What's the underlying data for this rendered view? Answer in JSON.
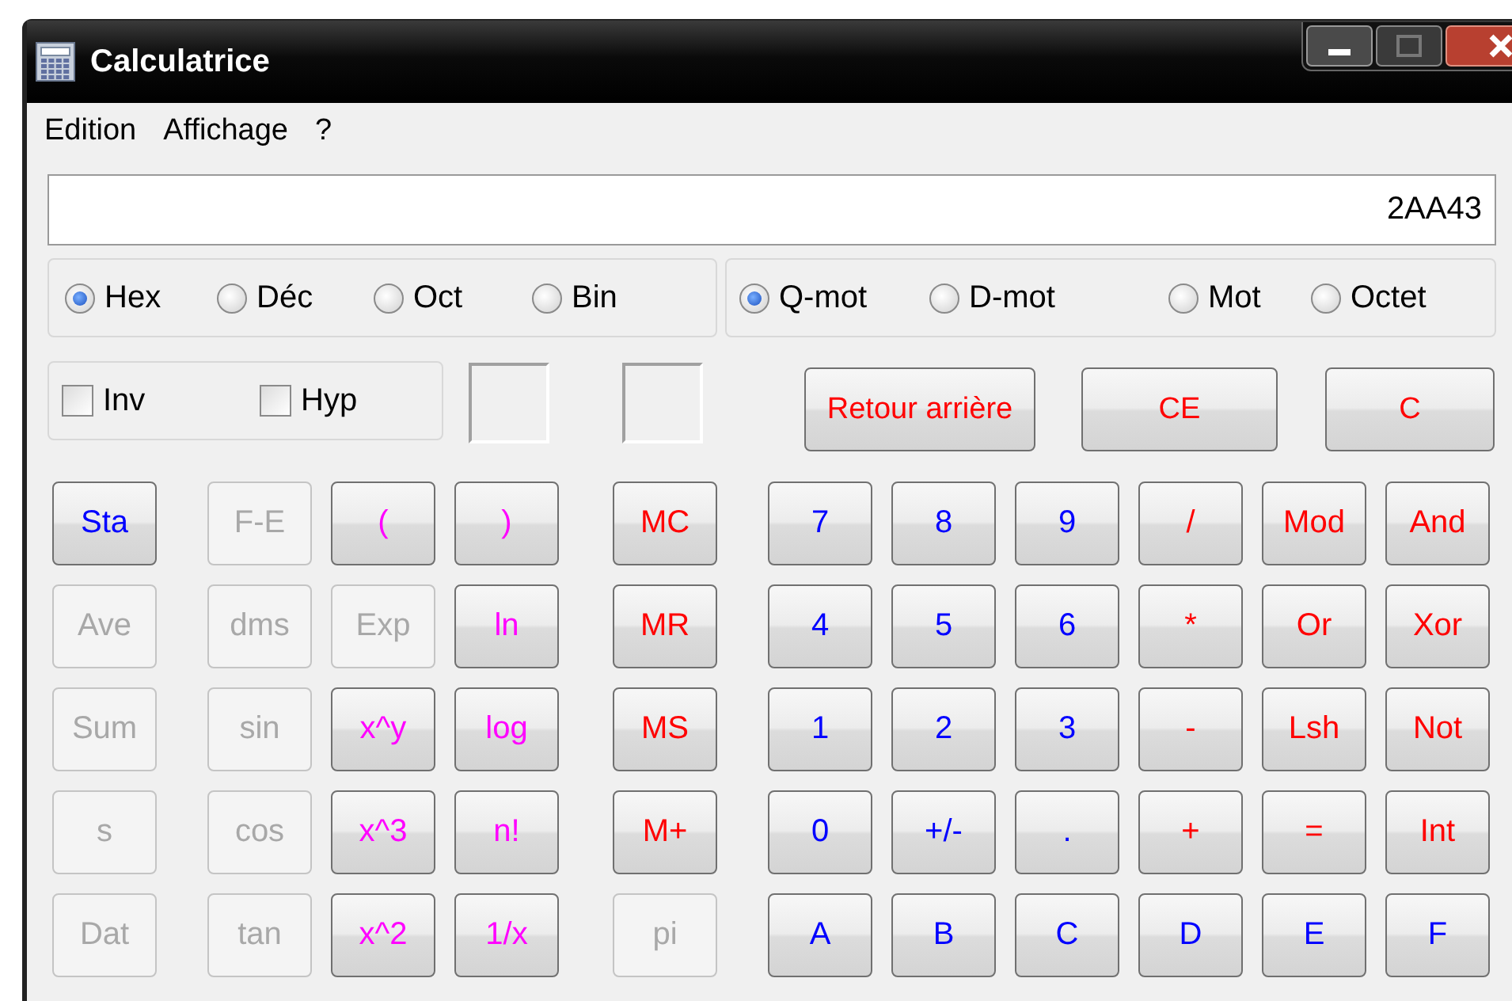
{
  "window": {
    "title": "Calculatrice"
  },
  "menu": [
    {
      "label": "Edition"
    },
    {
      "label": "Affichage"
    },
    {
      "label": "?"
    }
  ],
  "display": {
    "value": "2AA43"
  },
  "bases": [
    {
      "label": "Hex",
      "selected": true
    },
    {
      "label": "Déc",
      "selected": false
    },
    {
      "label": "Oct",
      "selected": false
    },
    {
      "label": "Bin",
      "selected": false
    }
  ],
  "word_sizes": [
    {
      "label": "Q-mot",
      "selected": true
    },
    {
      "label": "D-mot",
      "selected": false
    },
    {
      "label": "Mot",
      "selected": false
    },
    {
      "label": "Octet",
      "selected": false
    }
  ],
  "modifiers": [
    {
      "label": "Inv",
      "checked": false
    },
    {
      "label": "Hyp",
      "checked": false
    }
  ],
  "edit_buttons": [
    {
      "label": "Retour arrière",
      "color": "#ff0000"
    },
    {
      "label": "CE",
      "color": "#ff0000"
    },
    {
      "label": "C",
      "color": "#ff0000"
    }
  ],
  "keys": [
    [
      {
        "label": "Sta",
        "color": "#0000ff",
        "disabled": false
      },
      {
        "label": "F-E",
        "disabled": true
      },
      {
        "label": "(",
        "color": "#ff00ff",
        "disabled": false
      },
      {
        "label": ")",
        "color": "#ff00ff",
        "disabled": false
      },
      {
        "label": "MC",
        "color": "#ff0000",
        "disabled": false
      },
      {
        "label": "7",
        "color": "#0000ff",
        "disabled": false
      },
      {
        "label": "8",
        "color": "#0000ff",
        "disabled": false
      },
      {
        "label": "9",
        "color": "#0000ff",
        "disabled": false
      },
      {
        "label": "/",
        "color": "#ff0000",
        "disabled": false
      },
      {
        "label": "Mod",
        "color": "#ff0000",
        "disabled": false
      },
      {
        "label": "And",
        "color": "#ff0000",
        "disabled": false
      }
    ],
    [
      {
        "label": "Ave",
        "disabled": true
      },
      {
        "label": "dms",
        "disabled": true
      },
      {
        "label": "Exp",
        "disabled": true
      },
      {
        "label": "ln",
        "color": "#ff00ff",
        "disabled": false
      },
      {
        "label": "MR",
        "color": "#ff0000",
        "disabled": false
      },
      {
        "label": "4",
        "color": "#0000ff",
        "disabled": false
      },
      {
        "label": "5",
        "color": "#0000ff",
        "disabled": false
      },
      {
        "label": "6",
        "color": "#0000ff",
        "disabled": false
      },
      {
        "label": "*",
        "color": "#ff0000",
        "disabled": false
      },
      {
        "label": "Or",
        "color": "#ff0000",
        "disabled": false
      },
      {
        "label": "Xor",
        "color": "#ff0000",
        "disabled": false
      }
    ],
    [
      {
        "label": "Sum",
        "disabled": true
      },
      {
        "label": "sin",
        "disabled": true
      },
      {
        "label": "x^y",
        "color": "#ff00ff",
        "disabled": false
      },
      {
        "label": "log",
        "color": "#ff00ff",
        "disabled": false
      },
      {
        "label": "MS",
        "color": "#ff0000",
        "disabled": false
      },
      {
        "label": "1",
        "color": "#0000ff",
        "disabled": false
      },
      {
        "label": "2",
        "color": "#0000ff",
        "disabled": false
      },
      {
        "label": "3",
        "color": "#0000ff",
        "disabled": false
      },
      {
        "label": "-",
        "color": "#ff0000",
        "disabled": false
      },
      {
        "label": "Lsh",
        "color": "#ff0000",
        "disabled": false
      },
      {
        "label": "Not",
        "color": "#ff0000",
        "disabled": false
      }
    ],
    [
      {
        "label": "s",
        "disabled": true
      },
      {
        "label": "cos",
        "disabled": true
      },
      {
        "label": "x^3",
        "color": "#ff00ff",
        "disabled": false
      },
      {
        "label": "n!",
        "color": "#ff00ff",
        "disabled": false
      },
      {
        "label": "M+",
        "color": "#ff0000",
        "disabled": false
      },
      {
        "label": "0",
        "color": "#0000ff",
        "disabled": false
      },
      {
        "label": "+/-",
        "color": "#0000ff",
        "disabled": false
      },
      {
        "label": ".",
        "color": "#0000ff",
        "disabled": false
      },
      {
        "label": "+",
        "color": "#ff0000",
        "disabled": false
      },
      {
        "label": "=",
        "color": "#ff0000",
        "disabled": false
      },
      {
        "label": "Int",
        "color": "#ff0000",
        "disabled": false
      }
    ],
    [
      {
        "label": "Dat",
        "disabled": true
      },
      {
        "label": "tan",
        "disabled": true
      },
      {
        "label": "x^2",
        "color": "#ff00ff",
        "disabled": false
      },
      {
        "label": "1/x",
        "color": "#ff00ff",
        "disabled": false
      },
      {
        "label": "pi",
        "disabled": true
      },
      {
        "label": "A",
        "color": "#0000ff",
        "disabled": false
      },
      {
        "label": "B",
        "color": "#0000ff",
        "disabled": false
      },
      {
        "label": "C",
        "color": "#0000ff",
        "disabled": false
      },
      {
        "label": "D",
        "color": "#0000ff",
        "disabled": false
      },
      {
        "label": "E",
        "color": "#0000ff",
        "disabled": false
      },
      {
        "label": "F",
        "color": "#0000ff",
        "disabled": false
      }
    ]
  ]
}
